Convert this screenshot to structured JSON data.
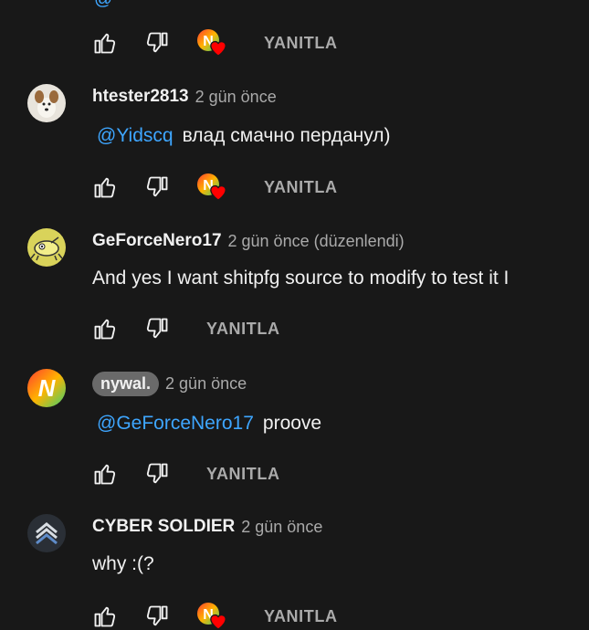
{
  "top_mention": "@",
  "reply_label": "YANITLA",
  "comments": [
    {
      "author": "htester2813",
      "time": "2 gün önce",
      "mention": "@Yidscq",
      "text": "влад смачно перданул)",
      "avatar": "dog-avatar",
      "creator_heart": true
    },
    {
      "author": "GeForceNero17",
      "time": "2 gün önce (düzenlendi)",
      "mention": "",
      "text": "And yes I want shitpfg source to modify to test it I",
      "avatar": "yellow-bug-avatar",
      "creator_heart": false
    },
    {
      "author": "nywal.",
      "time": "2 gün önce",
      "mention": "@GeForceNero17",
      "text": "proove",
      "avatar": "nywal-logo-avatar",
      "creator_heart": false
    },
    {
      "author": "CYBER SOLDIER",
      "time": "2 gün önce",
      "mention": "",
      "text": "why :(?",
      "avatar": "chevron-rank-avatar",
      "creator_heart": true
    }
  ],
  "colors": {
    "background": "#181818",
    "mention": "#3ea6ff",
    "muted": "#aaaaaa",
    "heart": "#ff0000"
  }
}
